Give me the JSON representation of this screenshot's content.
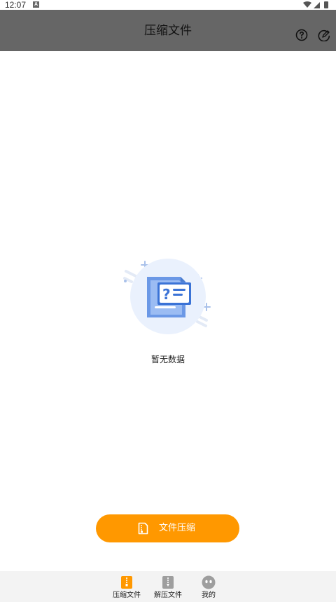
{
  "status_bar": {
    "time": "12:07",
    "notification_icon": "A",
    "icons": [
      "wifi-icon",
      "signal-icon",
      "battery-icon"
    ]
  },
  "app_bar": {
    "title": "压缩文件",
    "background": "#666666",
    "actions": [
      "help-circle-icon",
      "edit-circle-icon"
    ]
  },
  "empty_state": {
    "illustration_icon": "empty-document-question-icon",
    "message": "暂无数据"
  },
  "primary_action": {
    "label": "文件压缩",
    "icon": "document-icon",
    "color": "#FF9800"
  },
  "bottom_nav": {
    "items": [
      {
        "label": "压缩文件",
        "icon": "zip-file-icon",
        "active": true,
        "color": "#FF9800"
      },
      {
        "label": "解压文件",
        "icon": "unzip-file-icon",
        "active": false,
        "color": "#999999"
      },
      {
        "label": "我的",
        "icon": "profile-face-icon",
        "active": false,
        "color": "#999999"
      }
    ]
  }
}
